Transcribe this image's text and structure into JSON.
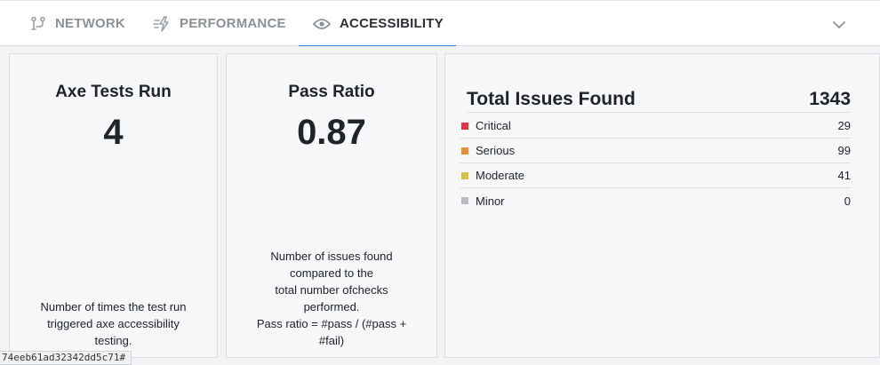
{
  "tabs": {
    "network": {
      "label": "NETWORK",
      "icon": "network-branch-icon"
    },
    "performance": {
      "label": "PERFORMANCE",
      "icon": "performance-bolt-icon"
    },
    "accessibility": {
      "label": "ACCESSIBILITY",
      "icon": "eye-icon",
      "active": true
    }
  },
  "colors": {
    "accent": "#2a79d4",
    "critical": "#e5343f",
    "serious": "#e8902f",
    "moderate": "#d4c13e",
    "minor": "#b9bcc0"
  },
  "cards": {
    "tests": {
      "title": "Axe Tests Run",
      "value": "4",
      "description": [
        "Number of times the test run",
        "triggered axe accessibility",
        "testing."
      ]
    },
    "ratio": {
      "title": "Pass Ratio",
      "value": "0.87",
      "description": [
        "Number of issues found",
        "compared to the",
        "total number ofchecks",
        "performed.",
        "Pass ratio = #pass / (#pass +",
        "#fail)"
      ]
    },
    "issues": {
      "title": "Total Issues Found",
      "total": "1343",
      "rows": [
        {
          "label": "Critical",
          "count": "29",
          "color": "#e5343f"
        },
        {
          "label": "Serious",
          "count": "99",
          "color": "#e8902f"
        },
        {
          "label": "Moderate",
          "count": "41",
          "color": "#d4c13e"
        },
        {
          "label": "Minor",
          "count": "0",
          "color": "#b9bcc0"
        }
      ]
    }
  },
  "status_bar": {
    "url": "74eeb61ad32342dd5c71#"
  }
}
